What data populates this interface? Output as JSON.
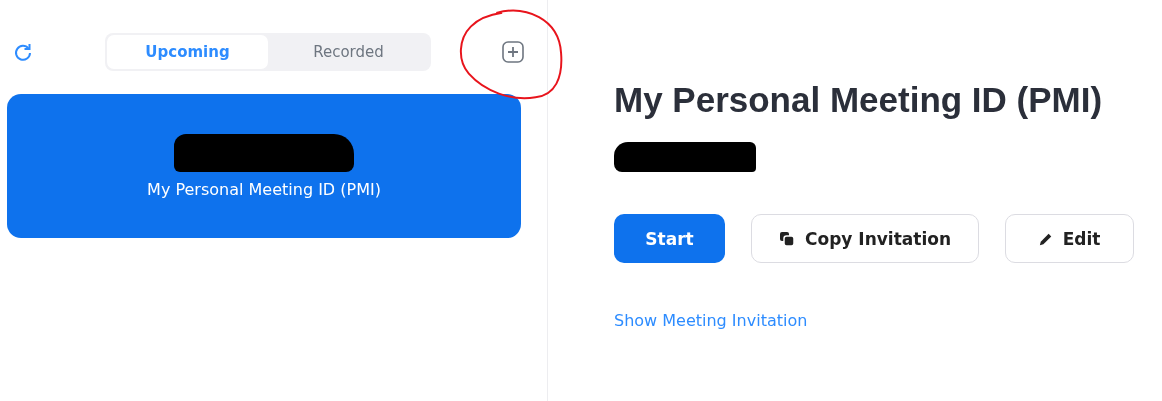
{
  "tabs": [
    {
      "label": "Upcoming",
      "selected": true
    },
    {
      "label": "Recorded",
      "selected": false
    }
  ],
  "meetings": [
    {
      "title": "My Personal Meeting ID (PMI)",
      "selected": true
    }
  ],
  "detail": {
    "title": "My Personal Meeting ID (PMI)",
    "buttons": [
      {
        "label": "Start",
        "kind": "primary"
      },
      {
        "label": "Copy Invitation",
        "kind": "copy"
      },
      {
        "label": "Edit",
        "kind": "edit"
      }
    ],
    "link": "Show Meeting Invitation"
  }
}
